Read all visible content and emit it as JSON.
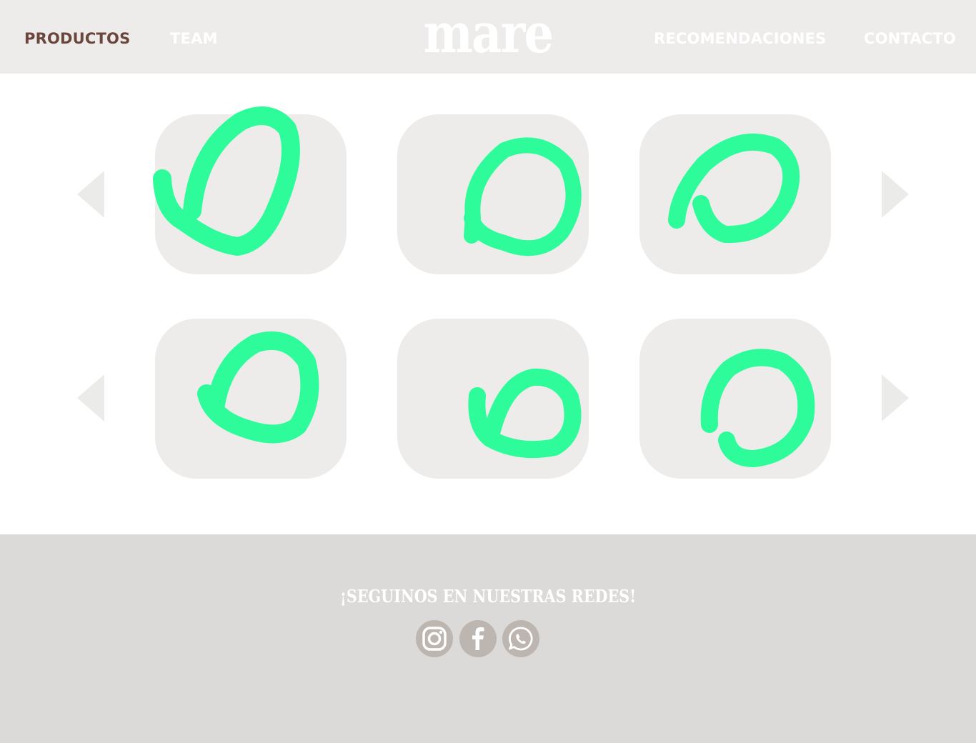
{
  "header": {
    "logo": "mare",
    "nav": [
      {
        "label": "PRODUCTOS"
      },
      {
        "label": "TEAM"
      },
      {
        "label": "RECOMENDACIONES"
      },
      {
        "label": "CONTACTO"
      }
    ]
  },
  "products": {
    "rows": [
      {
        "cards": [
          {
            "icon": "green-scribble-icon"
          },
          {
            "icon": "green-scribble-icon"
          },
          {
            "icon": "green-scribble-icon"
          }
        ]
      },
      {
        "cards": [
          {
            "icon": "green-scribble-icon"
          },
          {
            "icon": "green-scribble-icon"
          },
          {
            "icon": "green-scribble-icon"
          }
        ]
      }
    ],
    "prev_icon": "triangle-left-icon",
    "next_icon": "triangle-right-icon"
  },
  "footer": {
    "title": "¡SEGUINOS EN NUESTRAS REDES!",
    "social": [
      {
        "icon": "instagram-icon"
      },
      {
        "icon": "facebook-icon"
      },
      {
        "icon": "whatsapp-icon"
      }
    ]
  },
  "colors": {
    "header_bg": "#edecea",
    "nav_active": "#6a463c",
    "card_bg": "#edecea",
    "scribble": "#2efc9b",
    "footer_bg": "#dbdad8",
    "social_bg": "#bdb6b0"
  }
}
